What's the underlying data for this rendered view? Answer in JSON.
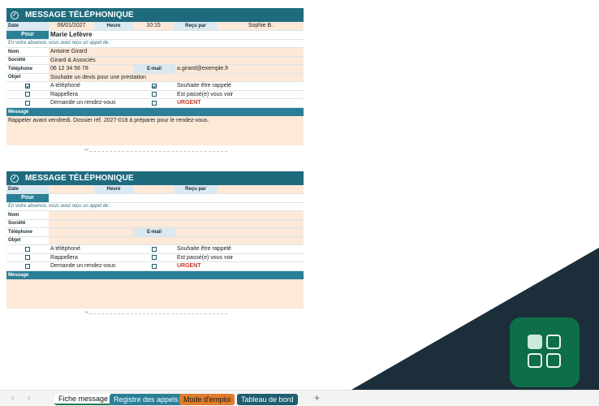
{
  "form1": {
    "title": "MESSAGE TÉLÉPHONIQUE",
    "date_label": "Date",
    "date_value": "06/01/2027",
    "heure_label": "Heure",
    "heure_value": "10:15",
    "recu_label": "Reçu par",
    "recu_value": "Sophie B.",
    "pour_label": "Pour",
    "pour_value": "Marie Lefèvre",
    "absence_note": "En votre absence, vous avez reçu un appel de :",
    "nom_label": "Nom",
    "nom_value": "Antoine Girard",
    "societe_label": "Société",
    "societe_value": "Girard & Associés",
    "telephone_label": "Téléphone",
    "telephone_value": "06 12 34 56 78",
    "email_label": "E-mail",
    "email_value": "a.girard@exemple.fr",
    "objet_label": "Objet",
    "objet_value": "Souhaite un devis pour une prestation",
    "opt_telephone": "A téléphoné",
    "opt_rappeler_souhait": "Souhaite être rappelé",
    "opt_rappellera": "Rappellera",
    "opt_passe": "Est passé(e) vous voir",
    "opt_rdv": "Demande un rendez-vous",
    "opt_urgent": "URGENT",
    "message_label": "Message",
    "message_value": "Rappeler avant vendredi. Dossier réf. 2027-018 à préparer pour le rendez-vous."
  },
  "form2": {
    "title": "MESSAGE TÉLÉPHONIQUE",
    "date_label": "Date",
    "heure_label": "Heure",
    "recu_label": "Reçu par",
    "pour_label": "Pour",
    "absence_note": "En votre absence, vous avez reçu un appel de :",
    "nom_label": "Nom",
    "societe_label": "Société",
    "telephone_label": "Téléphone",
    "email_label": "E-mail",
    "objet_label": "Objet",
    "opt_telephone": "A téléphoné",
    "opt_rappeler_souhait": "Souhaite être rappelé",
    "opt_rappellera": "Rappellera",
    "opt_passe": "Est passé(e) vous voir",
    "opt_rdv": "Demande un rendez-vous",
    "opt_urgent": "URGENT",
    "message_label": "Message"
  },
  "tabs": {
    "fiche": "Fiche message",
    "registre": "Registre des appels",
    "mode": "Mode d'emploi",
    "tableau": "Tableau de bord",
    "add": "+"
  },
  "nav": {
    "prev": "‹",
    "next": "›"
  },
  "scissors_glyph": "✂",
  "colors": {
    "header_teal": "#1e6b7d",
    "accent_teal": "#2b7f97",
    "peach": "#fce9d8",
    "light_blue": "#dbe9f1",
    "urgent_red": "#c0392b",
    "app_green": "#0e6e47"
  }
}
